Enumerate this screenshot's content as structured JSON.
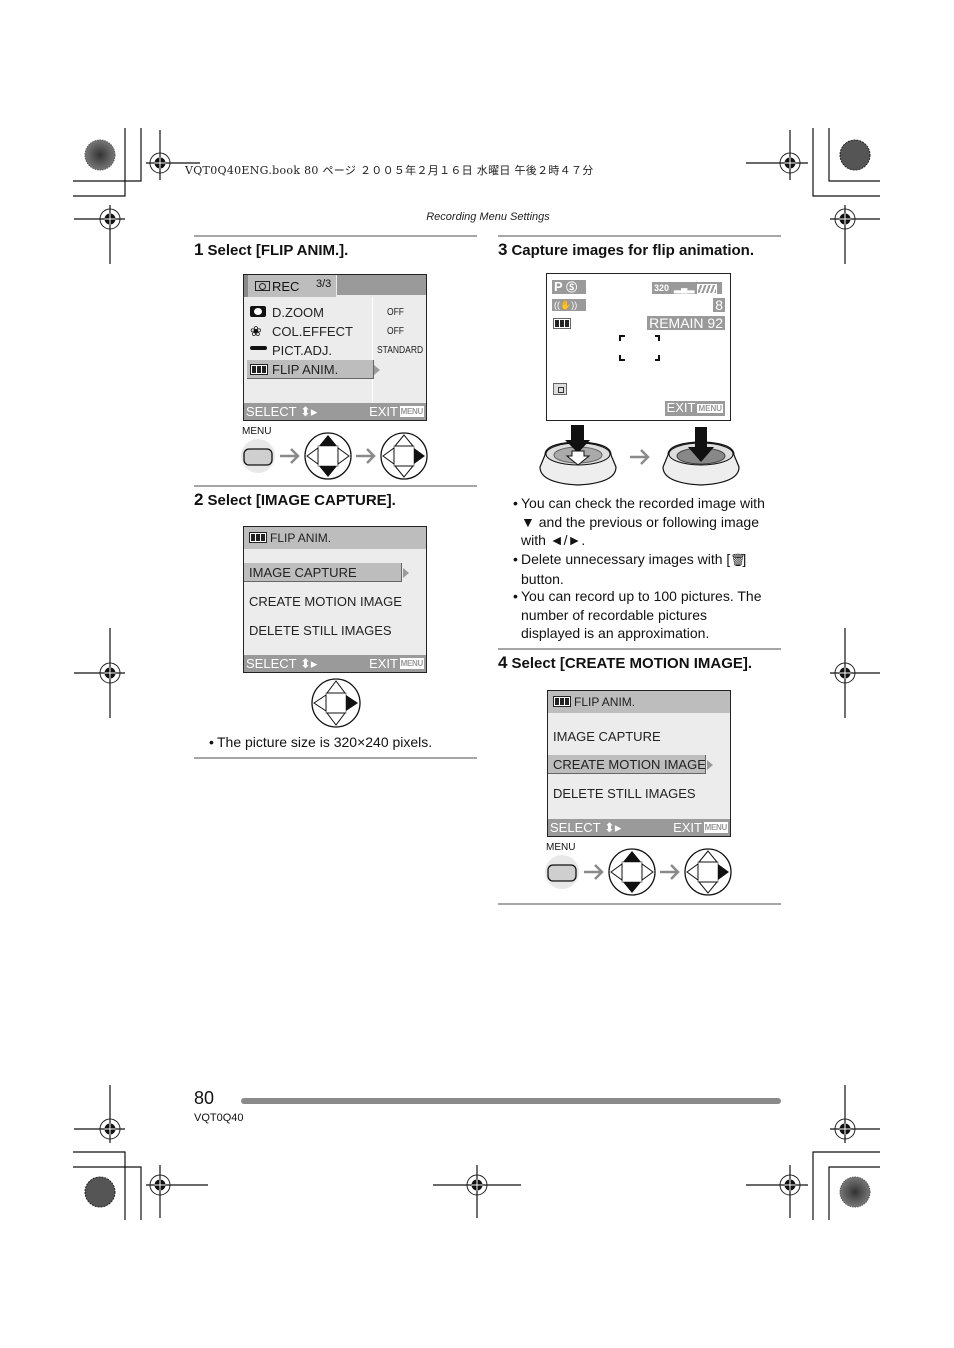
{
  "print_header": "VQT0Q40ENG.book   80 ページ   ２００５年２月１６日   水曜日   午後２時４７分",
  "running_head": "Recording Menu Settings",
  "steps": [
    {
      "num": "1",
      "title": "Select [FLIP ANIM.].",
      "screen": {
        "tab_label": "REC",
        "tab_page": "3/3",
        "items": [
          {
            "icon": "digital-zoom-icon",
            "label": "D.ZOOM",
            "value": "OFF"
          },
          {
            "icon": "color-effect-icon",
            "label": "COL.EFFECT",
            "value": "OFF"
          },
          {
            "icon": "picture-adjust-icon",
            "label": "PICT.ADJ.",
            "value": "STANDARD"
          },
          {
            "icon": "flip-anim-icon",
            "label": "FLIP ANIM.",
            "value": "",
            "selected": true
          }
        ],
        "footer_select": "SELECT",
        "footer_exit": "EXIT",
        "menu_badge": "MENU"
      },
      "button_label": "MENU"
    },
    {
      "num": "2",
      "title": "Select [IMAGE CAPTURE].",
      "screen": {
        "title": "FLIP ANIM.",
        "items": [
          {
            "label": "IMAGE CAPTURE",
            "selected": true
          },
          {
            "label": "CREATE MOTION IMAGE",
            "selected": false
          },
          {
            "label": "DELETE STILL IMAGES",
            "selected": false
          }
        ],
        "footer_select": "SELECT",
        "footer_exit": "EXIT",
        "menu_badge": "MENU"
      },
      "notes": [
        "The picture size is 320×240 pixels."
      ]
    },
    {
      "num": "3",
      "title": "Capture images for flip animation.",
      "screen": {
        "mode": "P",
        "picture_size": "320",
        "stabilizer_mode": "1",
        "count": "8",
        "remain_label": "REMAIN",
        "remain_value": "92",
        "footer_exit": "EXIT",
        "menu_badge": "MENU"
      },
      "notes": [
        "You can check the recorded image with ▼ and the previous or following image with ◄/►.",
        "Delete unnecessary images with [🗑] button.",
        "You can record up to 100 pictures. The number of recordable pictures displayed is an approximation."
      ]
    },
    {
      "num": "4",
      "title": "Select [CREATE MOTION IMAGE].",
      "screen": {
        "title": "FLIP ANIM.",
        "items": [
          {
            "label": "IMAGE CAPTURE",
            "selected": false
          },
          {
            "label": "CREATE MOTION IMAGE",
            "selected": true
          },
          {
            "label": "DELETE STILL IMAGES",
            "selected": false
          }
        ],
        "footer_select": "SELECT",
        "footer_exit": "EXIT",
        "menu_badge": "MENU"
      },
      "button_label": "MENU"
    }
  ],
  "note3_parts": {
    "a1": "You can check the recorded image with",
    "a2": "▼ and the previous or following image",
    "a3": "with ◄/►.",
    "b1": "Delete unnecessary images with [",
    "b1_end": "]",
    "b2": "button.",
    "c1": "You can record up to 100 pictures. The",
    "c2": "number of recordable pictures",
    "c3": "displayed is an approximation."
  },
  "footer": {
    "page_number": "80",
    "model_code": "VQT0Q40"
  }
}
